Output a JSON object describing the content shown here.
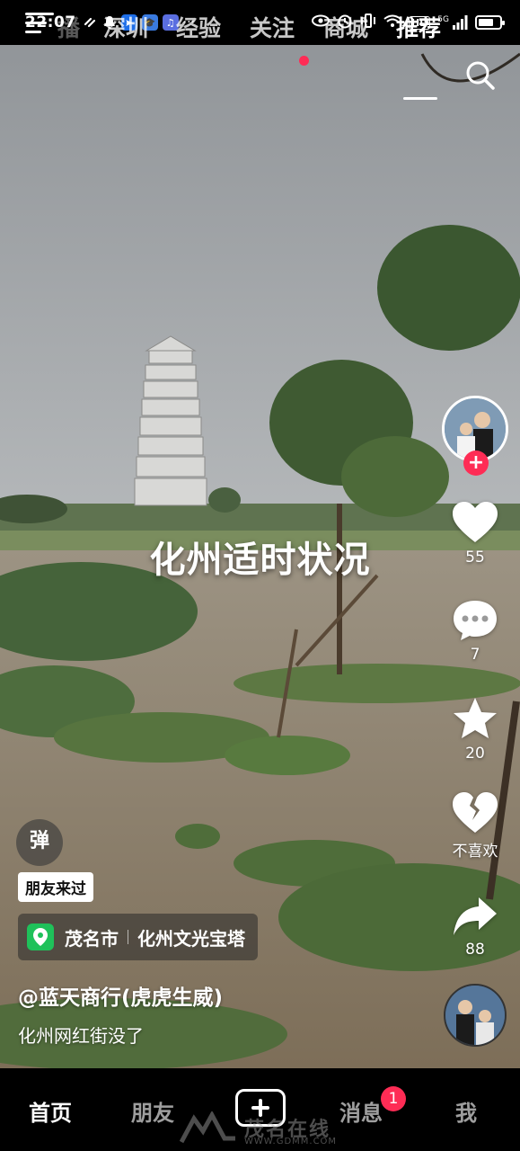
{
  "status_bar": {
    "time": "22:07",
    "more": "···",
    "hd_label": "HD",
    "network_label": "5G",
    "battery_level": 0.72,
    "icons": [
      "link-icon",
      "bell-icon",
      "app-blue-icon",
      "app-mortarboard-icon",
      "app-music-icon",
      "eye-icon",
      "alarm-icon",
      "vibrate-icon",
      "wifi-icon",
      "signal-icon",
      "battery-icon"
    ]
  },
  "top_nav": {
    "tabs": [
      {
        "label": "播",
        "state": "faded"
      },
      {
        "label": "深圳"
      },
      {
        "label": "经验"
      },
      {
        "label": "关注",
        "has_dot": true
      },
      {
        "label": "商城"
      },
      {
        "label": "推荐",
        "active": true
      }
    ]
  },
  "video": {
    "caption": "化州适时状况",
    "author": "@蓝天商行(虎虎生威)",
    "description": "化州网红街没了",
    "danmu_label": "弹",
    "friend_badge": "朋友来过",
    "location": {
      "city": "茂名市",
      "place": "化州文光宝塔"
    }
  },
  "actions": {
    "likes": "55",
    "comments": "7",
    "favorites": "20",
    "dislike_label": "不喜欢",
    "shares": "88"
  },
  "tab_bar": {
    "tabs": [
      {
        "label": "首页",
        "active": true
      },
      {
        "label": "朋友"
      },
      {
        "label": "消息",
        "badge": "1"
      },
      {
        "label": "我"
      }
    ]
  },
  "watermark": {
    "text": "茂名在线",
    "url": "WWW.GDMM.COM"
  },
  "colors": {
    "accent_red": "#fe2c55",
    "location_green": "#1fc15a"
  }
}
